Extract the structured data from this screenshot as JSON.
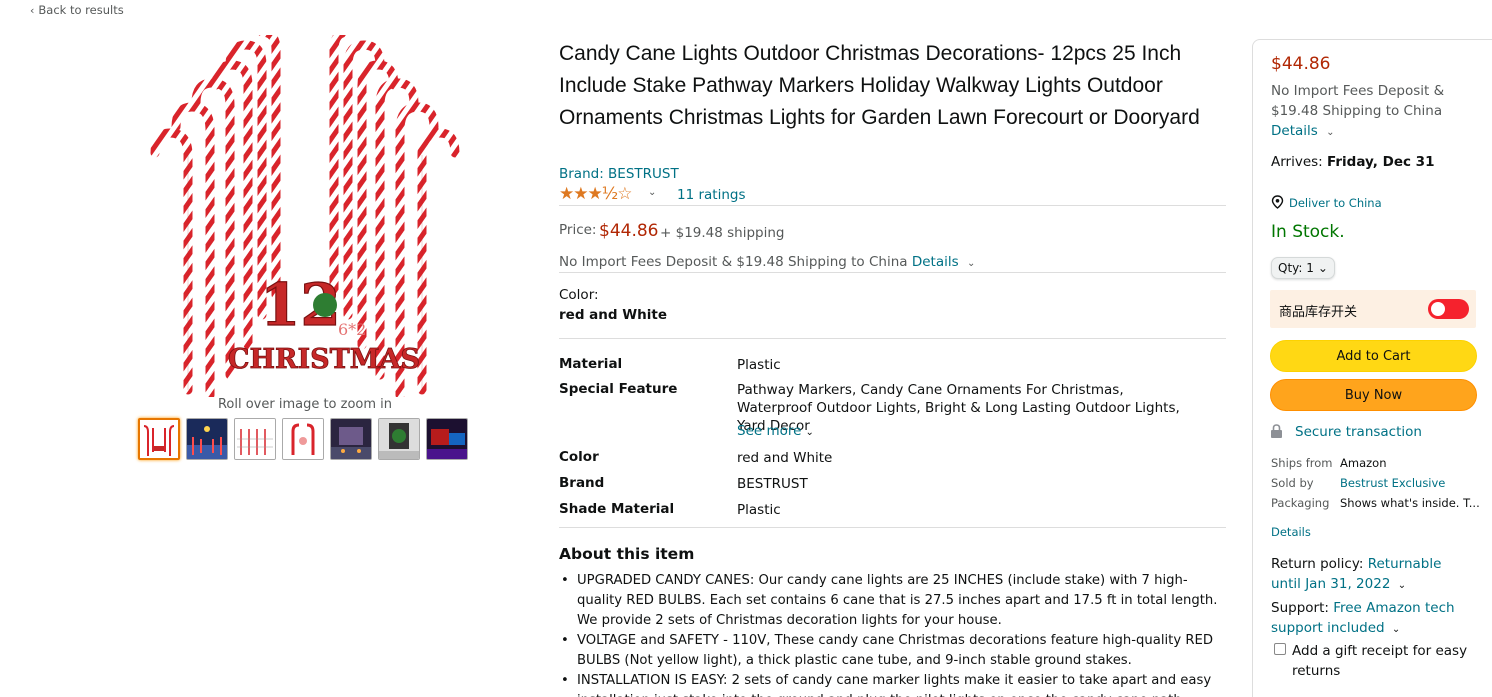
{
  "nav": {
    "back_label": "Back to results"
  },
  "gallery": {
    "zoom_hint": "Roll over image to zoom in",
    "hero_text_number": "12",
    "hero_text_sub": "6*2",
    "hero_text_word": "CHRISTMAS"
  },
  "product": {
    "title": "Candy Cane Lights Outdoor Christmas Decorations- 12pcs 25 Inch Include Stake Pathway Markers Holiday Walkway Lights Outdoor Ornaments Christmas Lights for Garden Lawn Forecourt or Dooryard",
    "brand": "Brand: BESTRUST",
    "stars": "★★★½☆",
    "rating_value": 3.5,
    "ratings_count": "11 ratings",
    "price_label": "Price:",
    "price": "$44.86",
    "shipping": "+ $19.48 shipping",
    "import_text": "No Import Fees Deposit & $19.48 Shipping to China",
    "import_details": "Details",
    "color_label": "Color:",
    "color_value": "red and White"
  },
  "specs": {
    "material_k": "Material",
    "material_v": "Plastic",
    "feature_k": "Special Feature",
    "feature_v": "Pathway Markers, Candy Cane Ornaments For Christmas, Waterproof Outdoor Lights, Bright & Long Lasting Outdoor Lights, Yard Decor",
    "see_more": "See more",
    "color_k": "Color",
    "color_v": "red and White",
    "brand_k": "Brand",
    "brand_v": "BESTRUST",
    "shade_k": "Shade Material",
    "shade_v": "Plastic"
  },
  "about": {
    "heading": "About this item",
    "b1": "UPGRADED CANDY CANES: Our candy cane lights are 25 INCHES (include stake) with 7 high-quality RED BULBS. Each set contains 6 cane that is 27.5 inches apart and 17.5 ft in total length. We provide 2 sets of Christmas decoration lights for your house.",
    "b2": "VOLTAGE and SAFETY - 110V, These candy cane Christmas decorations feature high-quality RED BULBS (Not yellow light), a thick plastic cane tube, and 9-inch stable ground stakes.",
    "b3": "INSTALLATION IS EASY: 2 sets of candy cane marker lights make it easier to take apart and easy installation just stake into the ground and plug the pilot lights on once the candy cane path"
  },
  "buybox": {
    "price": "$44.86",
    "import_text": "No Import Fees Deposit & $19.48 Shipping to China",
    "details": "Details",
    "arrives_label": "Arrives:",
    "arrives_date": "Friday, Dec 31",
    "deliver_to": "Deliver to China",
    "stock": "In Stock.",
    "qty": "Qty: 1",
    "toggle_label": "商品库存开关",
    "add_to_cart": "Add to Cart",
    "buy_now": "Buy Now",
    "secure": "Secure transaction",
    "ships_from_k": "Ships from",
    "ships_from_v": "Amazon",
    "sold_by_k": "Sold by",
    "sold_by_v": "Bestrust Exclusive",
    "packaging_k": "Packaging",
    "packaging_v": "Shows what's inside. T...",
    "details2": "Details",
    "return_label": "Return policy:",
    "return_value": "Returnable until Jan 31, 2022",
    "support_label": "Support:",
    "support_value": "Free Amazon tech support included",
    "gift": "Add a gift receipt for easy returns"
  },
  "colors": {
    "price_red": "#B12704",
    "link": "#007185",
    "stock_green": "#007600",
    "cart_yellow": "#FFD814",
    "buy_orange": "#FFA41C",
    "toggle_red": "#F5222D"
  }
}
